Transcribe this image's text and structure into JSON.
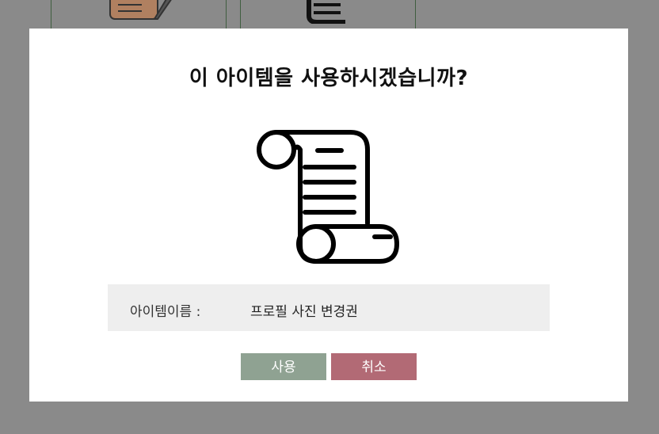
{
  "background": {
    "items": [
      {
        "icon": "quill-paper-icon"
      },
      {
        "icon": "scroll-icon"
      }
    ]
  },
  "modal": {
    "title": "이 아이템을 사용하시겠습니까?",
    "item_icon": "scroll-icon",
    "item_name_label": "아이템이름 :",
    "item_name_value": "프로필 사진 변경권",
    "use_button": "사용",
    "cancel_button": "취소"
  },
  "colors": {
    "overlay": "#8a8a8a",
    "info_box": "#eeeeee",
    "use_button": "#8fa292",
    "cancel_button": "#b26a75"
  }
}
